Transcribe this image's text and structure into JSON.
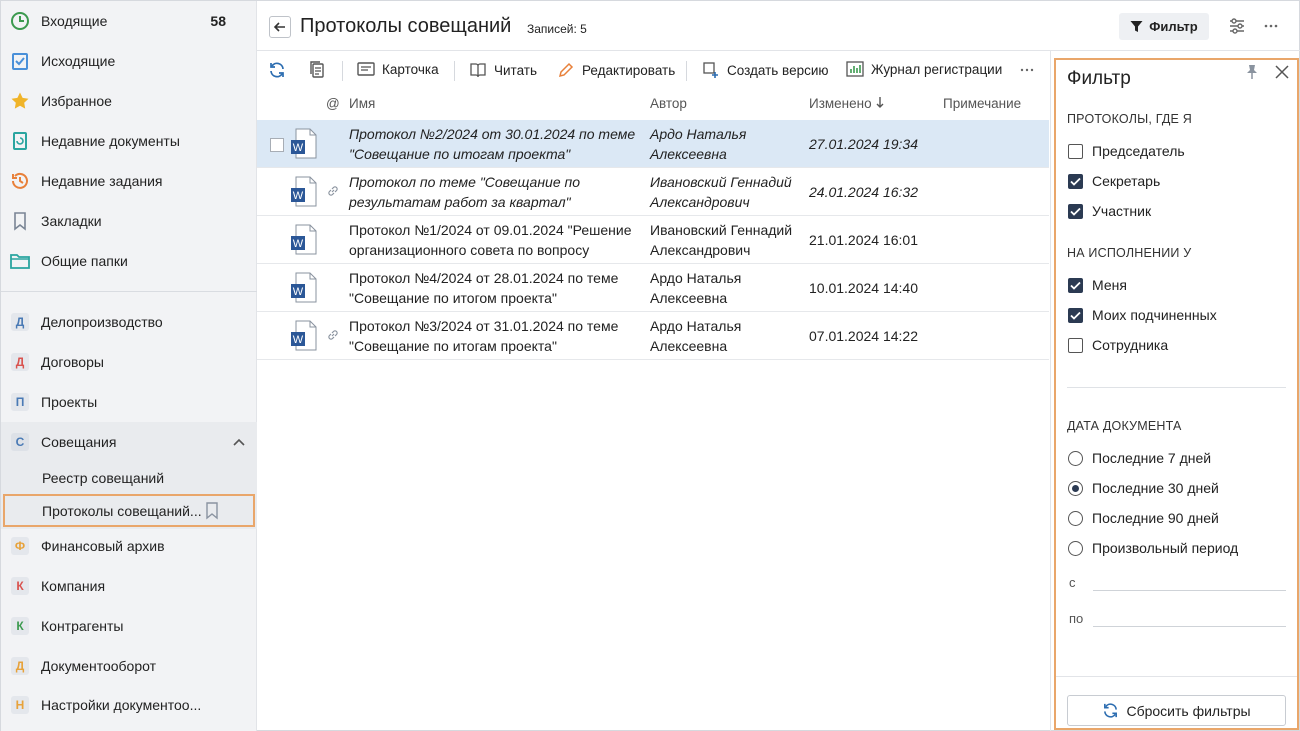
{
  "sidebar": {
    "top_items": [
      {
        "label": "Входящие",
        "count": "58",
        "icon": "clock-icon"
      },
      {
        "label": "Исходящие",
        "icon": "clipboard-check-icon"
      },
      {
        "label": "Избранное",
        "icon": "star-icon"
      },
      {
        "label": "Недавние документы",
        "icon": "document-history-icon"
      },
      {
        "label": "Недавние задания",
        "icon": "history-icon"
      },
      {
        "label": "Закладки",
        "icon": "bookmark-icon"
      },
      {
        "label": "Общие папки",
        "icon": "folder-icon"
      }
    ],
    "modules": [
      {
        "letter": "Д",
        "label": "Делопроизводство",
        "color": "#4a7ab5"
      },
      {
        "letter": "Д",
        "label": "Договоры",
        "color": "#d9534f"
      },
      {
        "letter": "П",
        "label": "Проекты",
        "color": "#4a7ab5"
      },
      {
        "letter": "С",
        "label": "Совещания",
        "color": "#4a7ab5"
      }
    ],
    "sub_items": [
      "Реестр совещаний",
      "Протоколы совещаний..."
    ],
    "modules_after": [
      {
        "letter": "Ф",
        "label": "Финансовый архив",
        "color": "#e7a23a"
      },
      {
        "letter": "К",
        "label": "Компания",
        "color": "#d9534f"
      },
      {
        "letter": "К",
        "label": "Контрагенты",
        "color": "#3c9a4f"
      },
      {
        "letter": "Д",
        "label": "Документооборот",
        "color": "#e7a23a"
      },
      {
        "letter": "Н",
        "label": "Настройки документоо...",
        "color": "#e7a23a"
      }
    ]
  },
  "header": {
    "title": "Протоколы совещаний",
    "records": "Записей: 5",
    "filter_label": "Фильтр"
  },
  "toolbar": {
    "card": "Карточка",
    "read": "Читать",
    "edit": "Редактировать",
    "create_version": "Создать версию",
    "journal": "Журнал регистрации"
  },
  "table": {
    "columns": {
      "at": "@",
      "name": "Имя",
      "author": "Автор",
      "modified": "Изменено",
      "note": "Примечание"
    },
    "rows": [
      {
        "name1": "Протокол №2/2024 от 30.01.2024 по теме",
        "name2": "\"Совещание по итогам проекта\"",
        "author1": "Ардо Наталья",
        "author2": "Алексеевна",
        "modified": "27.01.2024 19:34",
        "italic": true,
        "selected": true,
        "link": false
      },
      {
        "name1": "Протокол по теме \"Совещание по",
        "name2": "результатам работ за квартал\"",
        "author1": "Ивановский Геннадий",
        "author2": "Александрович",
        "modified": "24.01.2024 16:32",
        "italic": true,
        "selected": false,
        "link": true
      },
      {
        "name1": "Протокол №1/2024 от 09.01.2024 \"Решение",
        "name2": "организационного совета по вопросу",
        "author1": "Ивановский Геннадий",
        "author2": "Александрович",
        "modified": "21.01.2024 16:01",
        "italic": false,
        "selected": false,
        "link": false
      },
      {
        "name1": "Протокол №4/2024 от 28.01.2024 по теме",
        "name2": "\"Совещание по итогом проекта\"",
        "author1": "Ардо Наталья",
        "author2": "Алексеевна",
        "modified": "10.01.2024 14:40",
        "italic": false,
        "selected": false,
        "link": false
      },
      {
        "name1": "Протокол №3/2024 от 31.01.2024 по теме",
        "name2": "\"Совещание по итогам проекта\"",
        "author1": "Ардо Наталья",
        "author2": "Алексеевна",
        "modified": "07.01.2024 14:22",
        "italic": false,
        "selected": false,
        "link": true
      }
    ]
  },
  "filter": {
    "title": "Фильтр",
    "section1": "ПРОТОКОЛЫ, ГДЕ Я",
    "section1_items": [
      {
        "label": "Председатель",
        "checked": false
      },
      {
        "label": "Секретарь",
        "checked": true
      },
      {
        "label": "Участник",
        "checked": true
      }
    ],
    "section2": "НА ИСПОЛНЕНИИ У",
    "section2_items": [
      {
        "label": "Меня",
        "checked": true
      },
      {
        "label": "Моих подчиненных",
        "checked": true
      },
      {
        "label": "Сотрудника",
        "checked": false
      }
    ],
    "section3": "ДАТА ДОКУМЕНТА",
    "date_options": [
      {
        "label": "Последние 7 дней",
        "selected": false
      },
      {
        "label": "Последние 30 дней",
        "selected": true
      },
      {
        "label": "Последние 90 дней",
        "selected": false
      },
      {
        "label": "Произвольный период",
        "selected": false
      }
    ],
    "from_label": "с",
    "to_label": "по",
    "reset_label": "Сбросить фильтры"
  },
  "colors": {
    "accent_outline": "#e9a66a",
    "selected_row": "#dbe8f5",
    "checkbox": "#2b3a52",
    "word_icon": "#2b5797"
  }
}
